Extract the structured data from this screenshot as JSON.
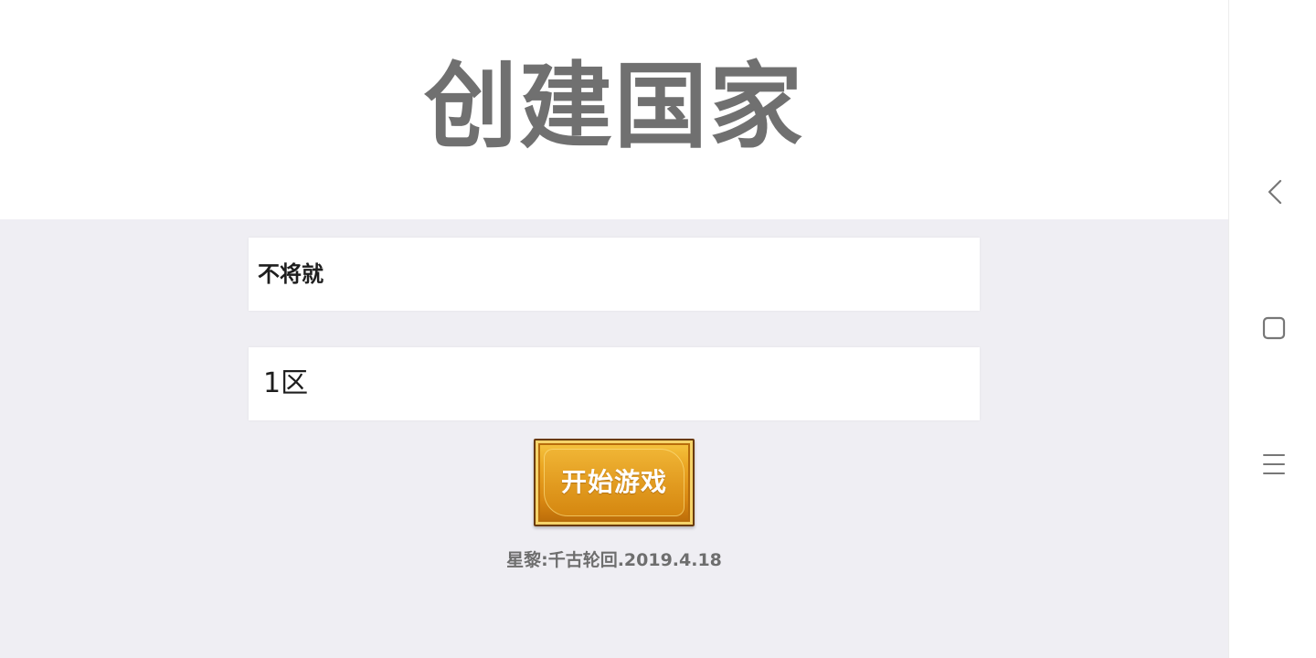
{
  "header": {
    "title": "创建国家"
  },
  "form": {
    "country_name_value": "不将就",
    "server_value": "1区"
  },
  "start_button": {
    "label": "开始游戏"
  },
  "footer": {
    "version": "星黎:千古轮回.2019.4.18"
  },
  "system_nav": {
    "back_icon": "chevron-left-icon",
    "home_icon": "rounded-square-icon",
    "menu_icon": "three-lines-icon"
  },
  "colors": {
    "title_gray": "#707070",
    "background": "#efeef3",
    "button_gold": "#eba724",
    "button_border": "#6a3a06"
  }
}
